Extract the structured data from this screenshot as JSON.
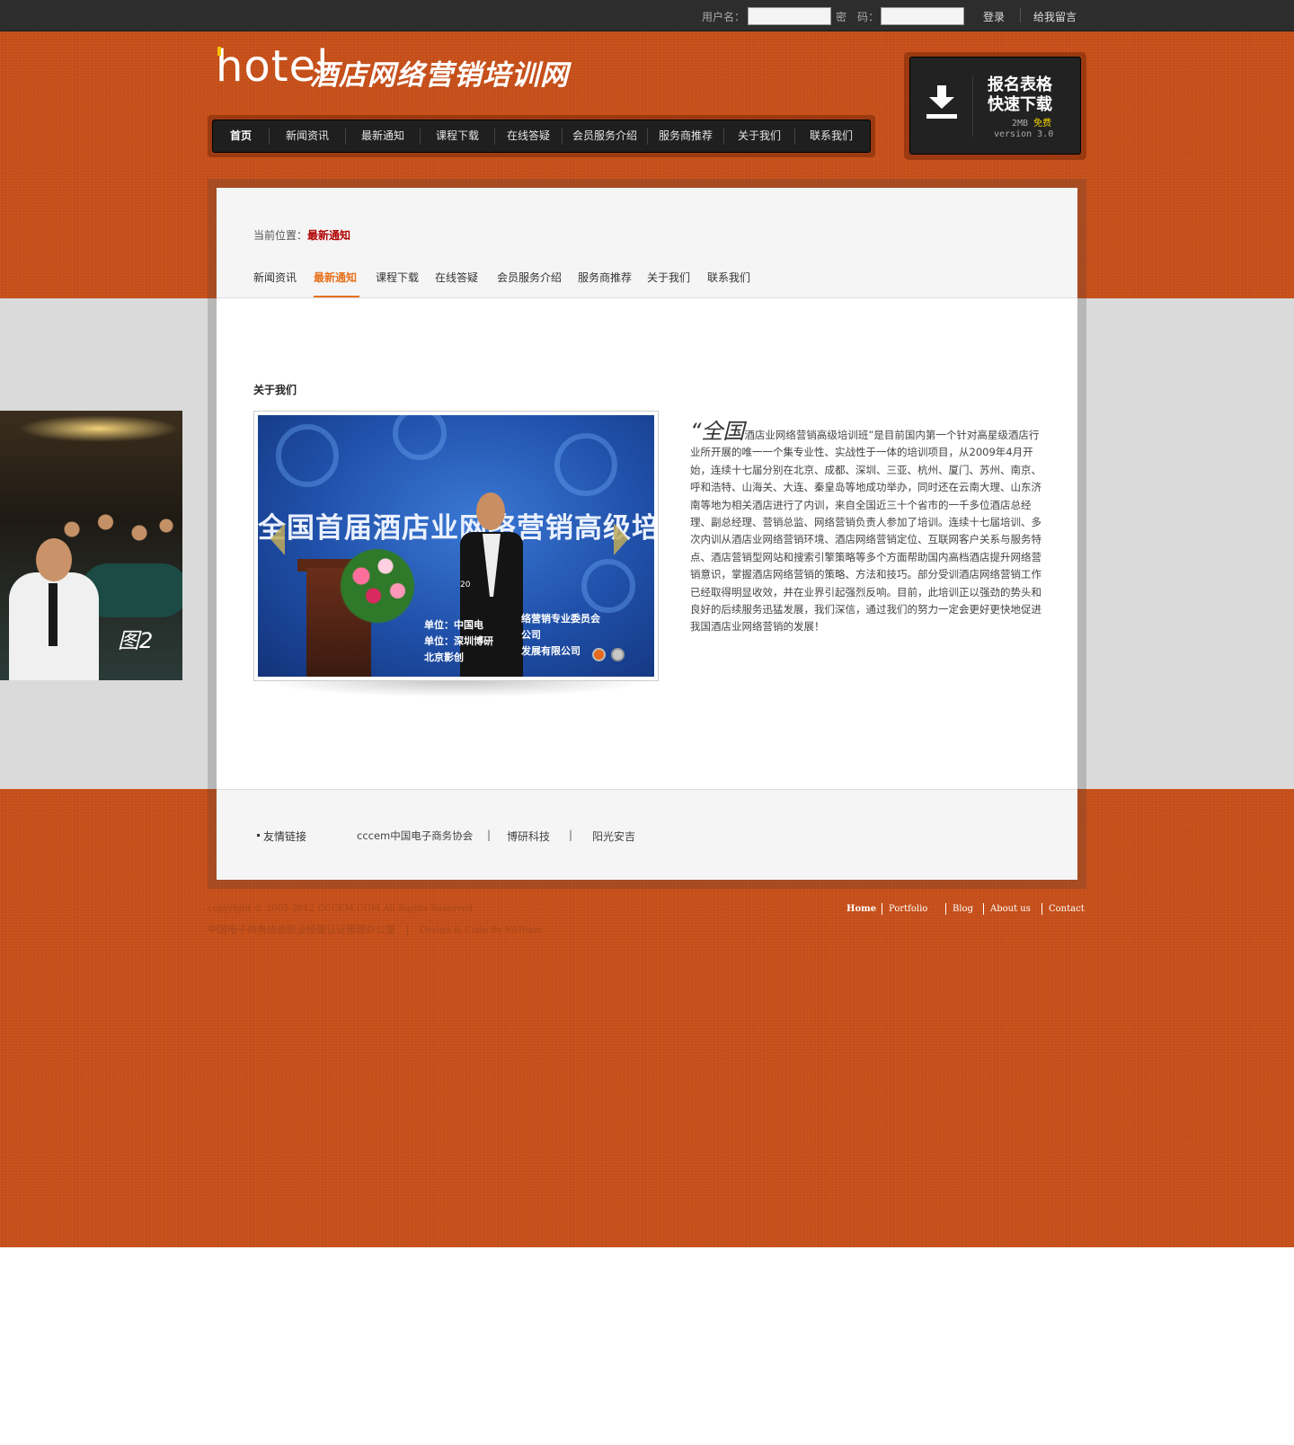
{
  "topbar": {
    "username_label": "用户名：",
    "password_label": "密　码：",
    "login": "登录",
    "message": "给我留言"
  },
  "logo": {
    "hotel": "hotel",
    "title": "酒店网络营销培训网"
  },
  "nav": {
    "items": [
      "首页",
      "新闻资讯",
      "最新通知",
      "课程下载",
      "在线答疑",
      "会员服务介绍",
      "服务商推荐",
      "关于我们",
      "联系我们"
    ]
  },
  "download": {
    "line1": "报名表格",
    "line2": "快速下载",
    "size": "2MB",
    "free": "免费",
    "version": "version 3.0",
    "icon": "download-icon"
  },
  "breadcrumb": {
    "label": "当前位置：",
    "current": "最新通知"
  },
  "subnav": {
    "items": [
      "新闻资讯",
      "最新通知",
      "课程下载",
      "在线答疑",
      "会员服务介绍",
      "服务商推荐",
      "关于我们",
      "联系我们"
    ],
    "active": "最新通知"
  },
  "section": {
    "title": "关于我们"
  },
  "slider": {
    "banner": "全国首届酒店业网络营销高级培",
    "sign_left": "单位：中国电\n单位：深圳博研\n北京影创",
    "sign_right": "络营销专业委员会\n公司\n发展有限公司",
    "date": "20",
    "dots": 2,
    "active_dot": 0
  },
  "intro": {
    "quote_big": "“全国",
    "text": "酒店业网络营销高级培训班”是目前国内第一个针对高星级酒店行业所开展的唯一一个集专业性、实战性于一体的培训项目，从2009年4月开始，连续十七届分别在北京、成都、深圳、三亚、杭州、厦门、苏州、南京、呼和浩特、山海关、大连、秦皇岛等地成功举办，同时还在云南大理、山东济南等地为相关酒店进行了内训，来自全国近三十个省市的一千多位酒店总经理、副总经理、营销总监、网络营销负责人参加了培训。连续十七届培训、多次内训从酒店业网络营销环境、酒店网络营销定位、互联网客户关系与服务特点、酒店营销型网站和搜索引擎策略等多个方面帮助国内高档酒店提升网络营销意识，掌握酒店网络营销的策略、方法和技巧。部分受训酒店网络营销工作已经取得明显收效，并在业界引起强烈反响。目前，此培训正以强劲的势头和良好的后续服务迅猛发展，我们深信，通过我们的努力一定会更好更快地促进我国酒店业网络营销的发展！"
  },
  "friends": {
    "label": "友情链接",
    "links": [
      "cccem中国电子商务协会",
      "博研科技",
      "阳光安吉"
    ],
    "separator": "|"
  },
  "left_photo": {
    "caption": "图2"
  },
  "footer": {
    "copyright": "copyright © 2005-2012 CCCEM.COM All Rights Reserved",
    "office": "中国电子商务协会职业经理认证管理办公室",
    "sep": "|",
    "design": "Design & Code By VATeam",
    "nav": [
      "Home",
      "Portfolio",
      "Blog",
      "About us",
      "Contact"
    ]
  },
  "colors": {
    "orange_bg": "#c8501a",
    "active_nav": "#e6711d",
    "breadcrumb_current": "#b00000",
    "free_highlight": "#f5d600"
  }
}
